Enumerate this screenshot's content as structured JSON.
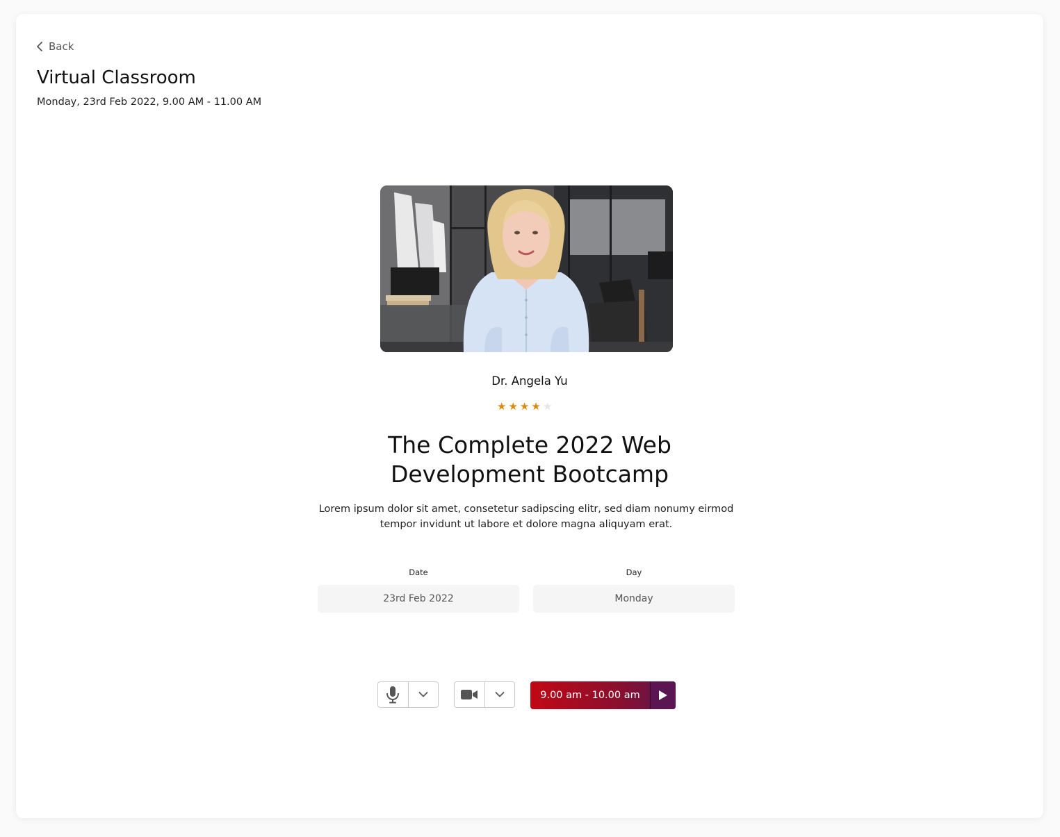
{
  "header": {
    "back_label": "Back",
    "title": "Virtual Classroom",
    "subtitle": "Monday, 23rd Feb 2022, 9.00 AM - 11.00 AM"
  },
  "instructor": {
    "name": "Dr. Angela Yu",
    "rating": 4,
    "rating_max": 5
  },
  "course": {
    "title_line1": "The Complete 2022 Web",
    "title_line2": "Development Bootcamp",
    "description_line1": "Lorem ipsum dolor sit amet, consetetur sadipscing elitr, sed diam nonumy eirmod",
    "description_line2": "tempor invidunt ut labore et dolore magna aliquyam erat."
  },
  "fields": {
    "date_label": "Date",
    "date_value": "23rd Feb 2022",
    "day_label": "Day",
    "day_value": "Monday"
  },
  "controls": {
    "mic_icon": "microphone-icon",
    "camera_icon": "video-camera-icon",
    "dropdown_icon": "chevron-down-icon",
    "join_label": "9.00 am - 10.00 am",
    "join_icon": "play-icon"
  },
  "colors": {
    "accent_start": "#c10816",
    "accent_end": "#5a1552",
    "star": "#e0870a",
    "star_off": "#e6e6e6"
  }
}
